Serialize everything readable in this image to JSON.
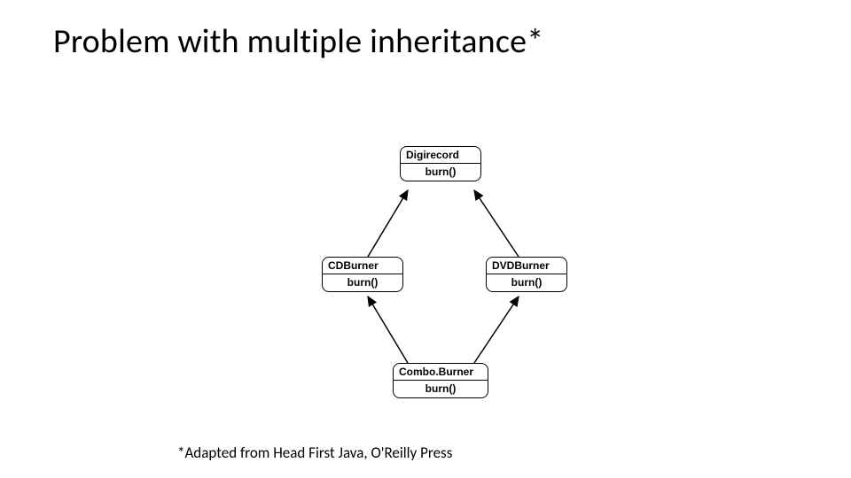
{
  "title": "Problem with multiple inheritance*",
  "footnote": "*Adapted from Head First Java, O'Reilly Press",
  "classes": {
    "top": {
      "name": "Digirecord",
      "method": "burn()"
    },
    "left": {
      "name": "CDBurner",
      "method": "burn()"
    },
    "right": {
      "name": "DVDBurner",
      "method": "burn()"
    },
    "bottom": {
      "name": "Combo.Burner",
      "method": "burn()"
    }
  }
}
